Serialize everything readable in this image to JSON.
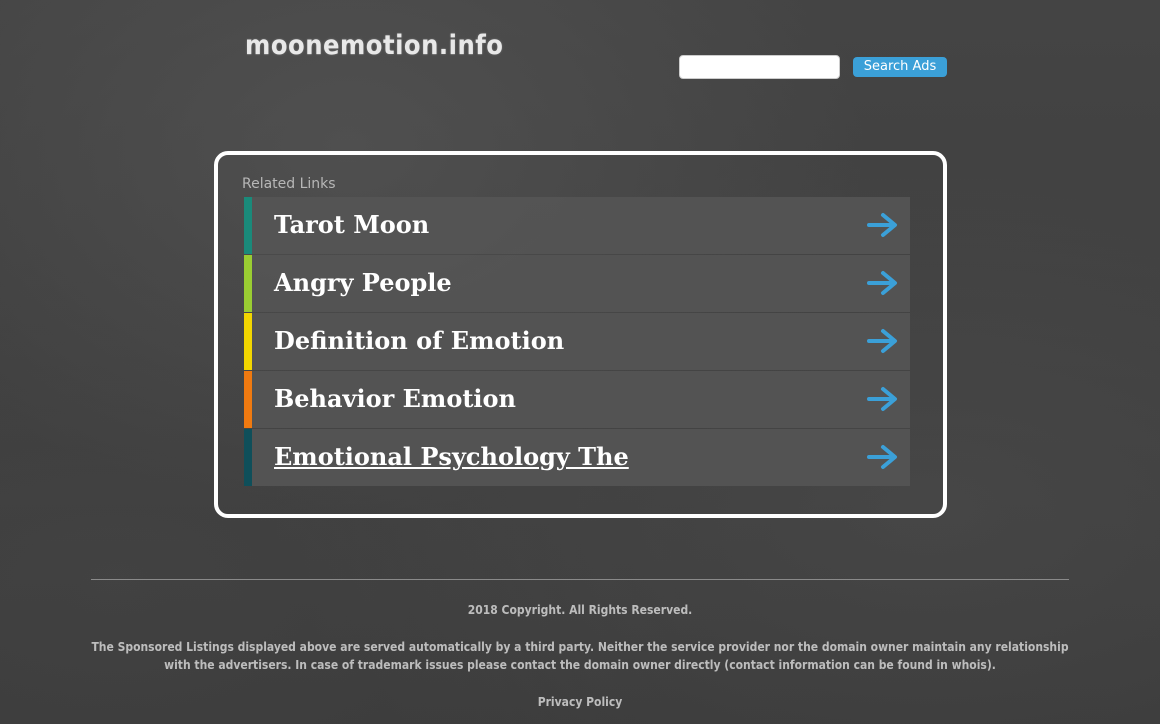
{
  "header": {
    "site_title": "moonemotion.info",
    "search_placeholder": "",
    "search_button_label": "Search Ads"
  },
  "links_box": {
    "label": "Related Links",
    "items": [
      {
        "label": "Tarot Moon",
        "accent": "#1a8a7a"
      },
      {
        "label": "Angry People",
        "accent": "#9acd32"
      },
      {
        "label": "Definition of Emotion",
        "accent": "#f2d600"
      },
      {
        "label": "Behavior Emotion",
        "accent": "#f07a10"
      },
      {
        "label": "Emotional Psychology The",
        "accent": "#0f4f5a"
      }
    ],
    "arrow_icon": "right-arrow-icon",
    "arrow_color": "#3ba0d8"
  },
  "footer": {
    "copyright": "2018 Copyright. All Rights Reserved.",
    "disclaimer": "The Sponsored Listings displayed above are served automatically by a third party. Neither the service provider nor the domain owner maintain any relationship with the advertisers. In case of trademark issues please contact the domain owner directly (contact information can be found in whois).",
    "privacy_label": "Privacy Policy"
  }
}
